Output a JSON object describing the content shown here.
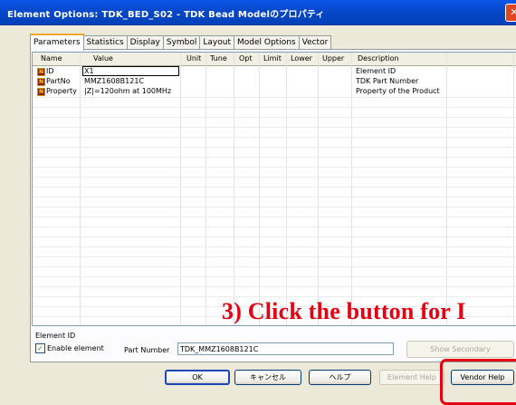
{
  "window": {
    "title": "Element Options: TDK_BED_S02 - TDK Bead Modelのプロパティ",
    "close_label": "✕"
  },
  "tabs": [
    "Parameters",
    "Statistics",
    "Display",
    "Symbol",
    "Layout",
    "Model Options",
    "Vector"
  ],
  "grid": {
    "columns": [
      "Name",
      "Value",
      "Unit",
      "Tune",
      "Opt",
      "Limit",
      "Lower",
      "Upper",
      "Description"
    ],
    "rows": [
      {
        "icon": "N",
        "name": "ID",
        "value": "X1",
        "description": "Element ID"
      },
      {
        "icon": "N",
        "name": "PartNo",
        "value": "MMZ1608B121C",
        "description": "TDK Part Number"
      },
      {
        "icon": "N",
        "name": "Property",
        "value": "|Z|=120ohm at 100MHz",
        "description": "Property of the Product"
      }
    ]
  },
  "footer": {
    "element_id_label": "Element ID",
    "enable_label": "Enable element",
    "enable_checked": true,
    "check_mark": "✓",
    "part_number_label": "Part Number",
    "part_number_value": "TDK_MMZ1608B121C",
    "show_secondary": "Show Secondary"
  },
  "buttons": {
    "ok": "OK",
    "cancel": "キャンセル",
    "help": "ヘルプ",
    "element_help": "Element Help",
    "vendor_help": "Vendor Help"
  },
  "annotation": {
    "text": "3) Click the button for I",
    "color": "#e60012"
  }
}
